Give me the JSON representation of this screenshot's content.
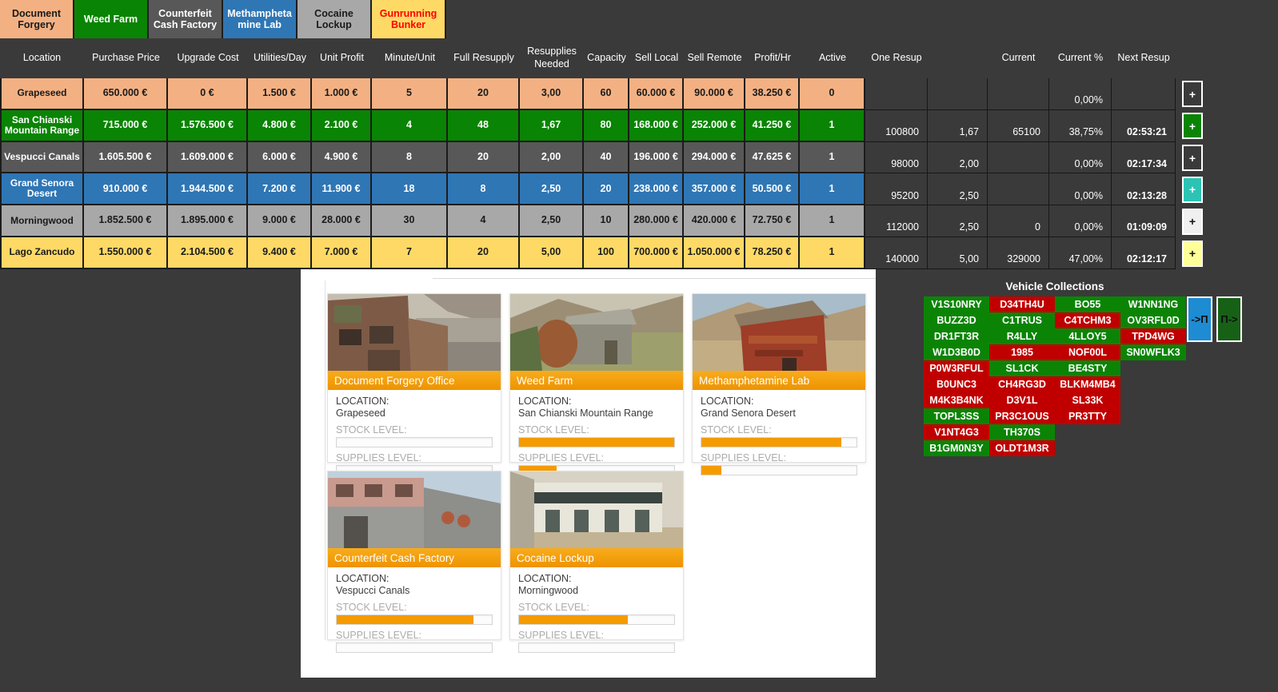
{
  "tabs": [
    {
      "label": "Document Forgery",
      "bg": "#F3B183",
      "fg": "#1a1a1a"
    },
    {
      "label": "Weed Farm",
      "bg": "#0A8404",
      "fg": "#ffffff"
    },
    {
      "label": "Counterfeit Cash Factory",
      "bg": "#585858",
      "fg": "#ffffff"
    },
    {
      "label": "Methamphetamine Lab",
      "bg": "#2F76B5",
      "fg": "#ffffff"
    },
    {
      "label": "Cocaine Lockup",
      "bg": "#A8A8A8",
      "fg": "#1a1a1a"
    },
    {
      "label": "Gunrunning Bunker",
      "bg": "#FFD965",
      "fg": "#FF0000"
    }
  ],
  "table": {
    "headers": [
      "Location",
      "Purchase Price",
      "Upgrade Cost",
      "Utilities/Day",
      "Unit Profit",
      "Minute/Unit",
      "Full Resupply",
      "Resupplies Needed",
      "Capacity",
      "Sell Local",
      "Sell Remote",
      "Profit/Hr",
      "Active",
      "One Resup",
      "",
      "Current",
      "Current %",
      "Next Resup"
    ],
    "add_button_label": "+",
    "rows": [
      {
        "location": "Grapeseed",
        "bg": "#F3B183",
        "fg": "#1a1a1a",
        "values": [
          "650.000 €",
          "0 €",
          "1.500 €",
          "1.000 €",
          "5",
          "20",
          "3,00",
          "60",
          "60.000 €",
          "90.000 €",
          "38.250 €",
          "0"
        ],
        "tracker": [
          "",
          "",
          "",
          "0,00%",
          ""
        ],
        "button": {
          "bg": "#3A3A3A",
          "fg": "#ffffff"
        }
      },
      {
        "location": "San Chianski Mountain Range",
        "bg": "#0A8404",
        "fg": "#ffffff",
        "values": [
          "715.000 €",
          "1.576.500 €",
          "4.800 €",
          "2.100 €",
          "4",
          "48",
          "1,67",
          "80",
          "168.000 €",
          "252.000 €",
          "41.250 €",
          "1"
        ],
        "tracker": [
          "100800",
          "1,67",
          "65100",
          "38,75%",
          "02:53:21"
        ],
        "button": {
          "bg": "#0A8404",
          "fg": "#ffffff"
        }
      },
      {
        "location": "Vespucci Canals",
        "bg": "#585858",
        "fg": "#ffffff",
        "values": [
          "1.605.500 €",
          "1.609.000 €",
          "6.000 €",
          "4.900 €",
          "8",
          "20",
          "2,00",
          "40",
          "196.000 €",
          "294.000 €",
          "47.625 €",
          "1"
        ],
        "tracker": [
          "98000",
          "2,00",
          "",
          "0,00%",
          "02:17:34"
        ],
        "button": {
          "bg": "#3A3A3A",
          "fg": "#ffffff"
        }
      },
      {
        "location": "Grand Senora Desert",
        "bg": "#2F76B5",
        "fg": "#ffffff",
        "values": [
          "910.000 €",
          "1.944.500 €",
          "7.200 €",
          "11.900 €",
          "18",
          "8",
          "2,50",
          "20",
          "238.000 €",
          "357.000 €",
          "50.500 €",
          "1"
        ],
        "tracker": [
          "95200",
          "2,50",
          "",
          "0,00%",
          "02:13:28"
        ],
        "button": {
          "bg": "#2BC4B4",
          "fg": "#ffffff"
        }
      },
      {
        "location": "Morningwood",
        "bg": "#A8A8A8",
        "fg": "#1a1a1a",
        "values": [
          "1.852.500 €",
          "1.895.000 €",
          "9.000 €",
          "28.000 €",
          "30",
          "4",
          "2,50",
          "10",
          "280.000 €",
          "420.000 €",
          "72.750 €",
          "1"
        ],
        "tracker": [
          "112000",
          "2,50",
          "0",
          "0,00%",
          "01:09:09"
        ],
        "button": {
          "bg": "#F0F0F0",
          "fg": "#111111"
        }
      },
      {
        "location": "Lago Zancudo",
        "bg": "#FFD965",
        "fg": "#1a1a1a",
        "values": [
          "1.550.000 €",
          "2.104.500 €",
          "9.400 €",
          "7.000 €",
          "7",
          "20",
          "5,00",
          "100",
          "700.000 €",
          "1.050.000 €",
          "78.250 €",
          "1"
        ],
        "tracker": [
          "140000",
          "5,00",
          "329000",
          "47,00%",
          "02:12:17"
        ],
        "button": {
          "bg": "#FFFF99",
          "fg": "#111111"
        }
      }
    ]
  },
  "panel": {
    "labels": {
      "location": "LOCATION:",
      "stock": "STOCK LEVEL:",
      "supplies": "SUPPLIES LEVEL:"
    },
    "accent_orange": "#F59B00",
    "cards": [
      {
        "title": "Document Forgery Office",
        "location": "Grapeseed",
        "stock_pct": 0,
        "supplies_pct": 0
      },
      {
        "title": "Weed Farm",
        "location": "San Chianski Mountain Range",
        "stock_pct": 100,
        "supplies_pct": 24
      },
      {
        "title": "Methamphetamine Lab",
        "location": "Grand Senora Desert",
        "stock_pct": 90,
        "supplies_pct": 13
      },
      {
        "title": "Counterfeit Cash Factory",
        "location": "Vespucci Canals",
        "stock_pct": 88,
        "supplies_pct": 0
      },
      {
        "title": "Cocaine Lockup",
        "location": "Morningwood",
        "stock_pct": 70,
        "supplies_pct": 0
      }
    ]
  },
  "vehicles": {
    "title": "Vehicle Collections",
    "colors": {
      "green": "#0B8406",
      "red": "#C00000"
    },
    "rows": [
      [
        {
          "code": "V1S10NRY",
          "color": "green"
        },
        {
          "code": "D34TH4U",
          "color": "red"
        },
        {
          "code": "BO55",
          "color": "green"
        },
        {
          "code": "W1NN1NG",
          "color": "green"
        }
      ],
      [
        {
          "code": "BUZZ3D",
          "color": "green"
        },
        {
          "code": "C1TRUS",
          "color": "green"
        },
        {
          "code": "C4TCHM3",
          "color": "red"
        },
        {
          "code": "OV3RFL0D",
          "color": "green"
        }
      ],
      [
        {
          "code": "DR1FT3R",
          "color": "green"
        },
        {
          "code": "R4LLY",
          "color": "green"
        },
        {
          "code": "4LLOY5",
          "color": "green"
        },
        {
          "code": "TPD4WG",
          "color": "red"
        }
      ],
      [
        {
          "code": "W1D3B0D",
          "color": "green"
        },
        {
          "code": "1985",
          "color": "red"
        },
        {
          "code": "NOF00L",
          "color": "red"
        },
        {
          "code": "SN0WFLK3",
          "color": "green"
        }
      ],
      [
        {
          "code": "P0W3RFUL",
          "color": "red"
        },
        {
          "code": "SL1CK",
          "color": "green"
        },
        {
          "code": "BE4STY",
          "color": "green"
        }
      ],
      [
        {
          "code": "B0UNC3",
          "color": "red"
        },
        {
          "code": "CH4RG3D",
          "color": "red"
        },
        {
          "code": "BLKM4MB4",
          "color": "red"
        }
      ],
      [
        {
          "code": "M4K3B4NK",
          "color": "red"
        },
        {
          "code": "D3V1L",
          "color": "red"
        },
        {
          "code": "SL33K",
          "color": "red"
        }
      ],
      [
        {
          "code": "TOPL3SS",
          "color": "green"
        },
        {
          "code": "PR3C1OUS",
          "color": "red"
        },
        {
          "code": "PR3TTY",
          "color": "red"
        }
      ],
      [
        {
          "code": "V1NT4G3",
          "color": "red"
        },
        {
          "code": "TH370S",
          "color": "green"
        }
      ],
      [
        {
          "code": "B1GM0N3Y",
          "color": "green"
        },
        {
          "code": "OLDT1M3R",
          "color": "red"
        }
      ]
    ],
    "buttons": [
      {
        "label": "->П",
        "bg": "#1D8CD3"
      },
      {
        "label": "П->",
        "bg": "#176117"
      }
    ]
  }
}
